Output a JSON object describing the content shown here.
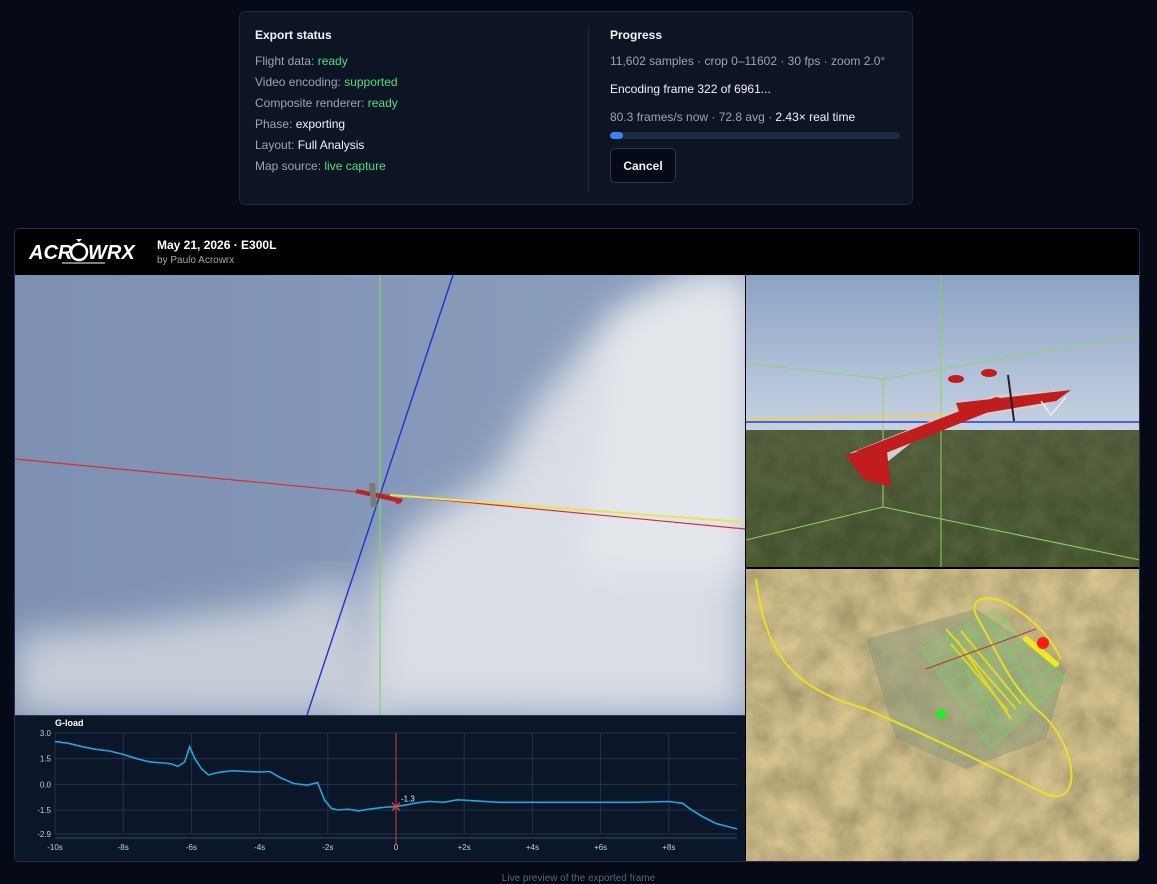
{
  "export_status": {
    "title": "Export status",
    "items": [
      {
        "label": "Flight data:",
        "value": "ready",
        "style": "green"
      },
      {
        "label": "Video encoding:",
        "value": "supported",
        "style": "green"
      },
      {
        "label": "Composite renderer:",
        "value": "ready",
        "style": "green"
      },
      {
        "label": "Phase:",
        "value": "exporting",
        "style": "white"
      },
      {
        "label": "Layout:",
        "value": "Full Analysis",
        "style": "white"
      },
      {
        "label": "Map source:",
        "value": "live capture",
        "style": "green"
      }
    ]
  },
  "progress": {
    "title": "Progress",
    "meta": "11,602 samples · crop 0–11602 · 30 fps · zoom 2.0°",
    "encoding_text": "Encoding frame 322 of 6961...",
    "rate_text": "80.3 frames/s now · 72.8 avg · ",
    "realtime_text": "2.43× real time",
    "fraction": 0.046,
    "cancel_label": "Cancel"
  },
  "preview": {
    "logo_text": "ACROWRX",
    "flight_title": "May 21, 2026 · E300L",
    "pilot": "by Paulo Acrowrx"
  },
  "chart_data": {
    "type": "line",
    "title": "G-load",
    "ylim": [
      -2.9,
      3.0
    ],
    "yticks": [
      "3.0",
      "1.5",
      "0.0",
      "-1.5",
      "-2.9"
    ],
    "ytick_values": [
      3.0,
      1.5,
      0.0,
      -1.5,
      -2.9
    ],
    "xlim": [
      -10,
      10
    ],
    "xticks": [
      "-10s",
      "-8s",
      "-6s",
      "-4s",
      "-2s",
      "0",
      "+2s",
      "+4s",
      "+6s",
      "+8s"
    ],
    "xtick_values": [
      -10,
      -8,
      -6,
      -4,
      -2,
      0,
      2,
      4,
      6,
      8
    ],
    "cursor_x": 0,
    "cursor_value": -1.3,
    "cursor_label": "-1.3",
    "series": [
      {
        "color": "#1fa5e0",
        "x": [
          -10,
          -9.6,
          -9.2,
          -8.8,
          -8.4,
          -8.0,
          -7.6,
          -7.2,
          -6.8,
          -6.6,
          -6.4,
          -6.2,
          -6.05,
          -5.9,
          -5.7,
          -5.5,
          -5.2,
          -4.8,
          -4.4,
          -4.0,
          -3.7,
          -3.4,
          -3.0,
          -2.6,
          -2.3,
          -2.1,
          -1.9,
          -1.7,
          -1.4,
          -1.1,
          -0.8,
          -0.4,
          0,
          0.3,
          0.7,
          1.0,
          1.4,
          1.8,
          2.2,
          3.0,
          4.0,
          5.0,
          6.0,
          7.0,
          8.0,
          8.4,
          8.6,
          9.0,
          9.4,
          10.0
        ],
        "y": [
          2.5,
          2.4,
          2.2,
          2.05,
          1.95,
          1.75,
          1.5,
          1.3,
          1.25,
          1.2,
          1.05,
          1.3,
          2.2,
          1.5,
          0.9,
          0.55,
          0.7,
          0.8,
          0.75,
          0.72,
          0.75,
          0.4,
          0.05,
          -0.05,
          0.1,
          -0.9,
          -1.4,
          -1.5,
          -1.45,
          -1.55,
          -1.45,
          -1.35,
          -1.3,
          -1.2,
          -1.05,
          -1.0,
          -1.05,
          -0.9,
          -0.95,
          -1.05,
          -1.05,
          -1.05,
          -1.05,
          -1.05,
          -1.0,
          -1.1,
          -1.4,
          -1.9,
          -2.3,
          -2.6
        ]
      }
    ]
  },
  "footer_note": "Live preview of the exported frame"
}
